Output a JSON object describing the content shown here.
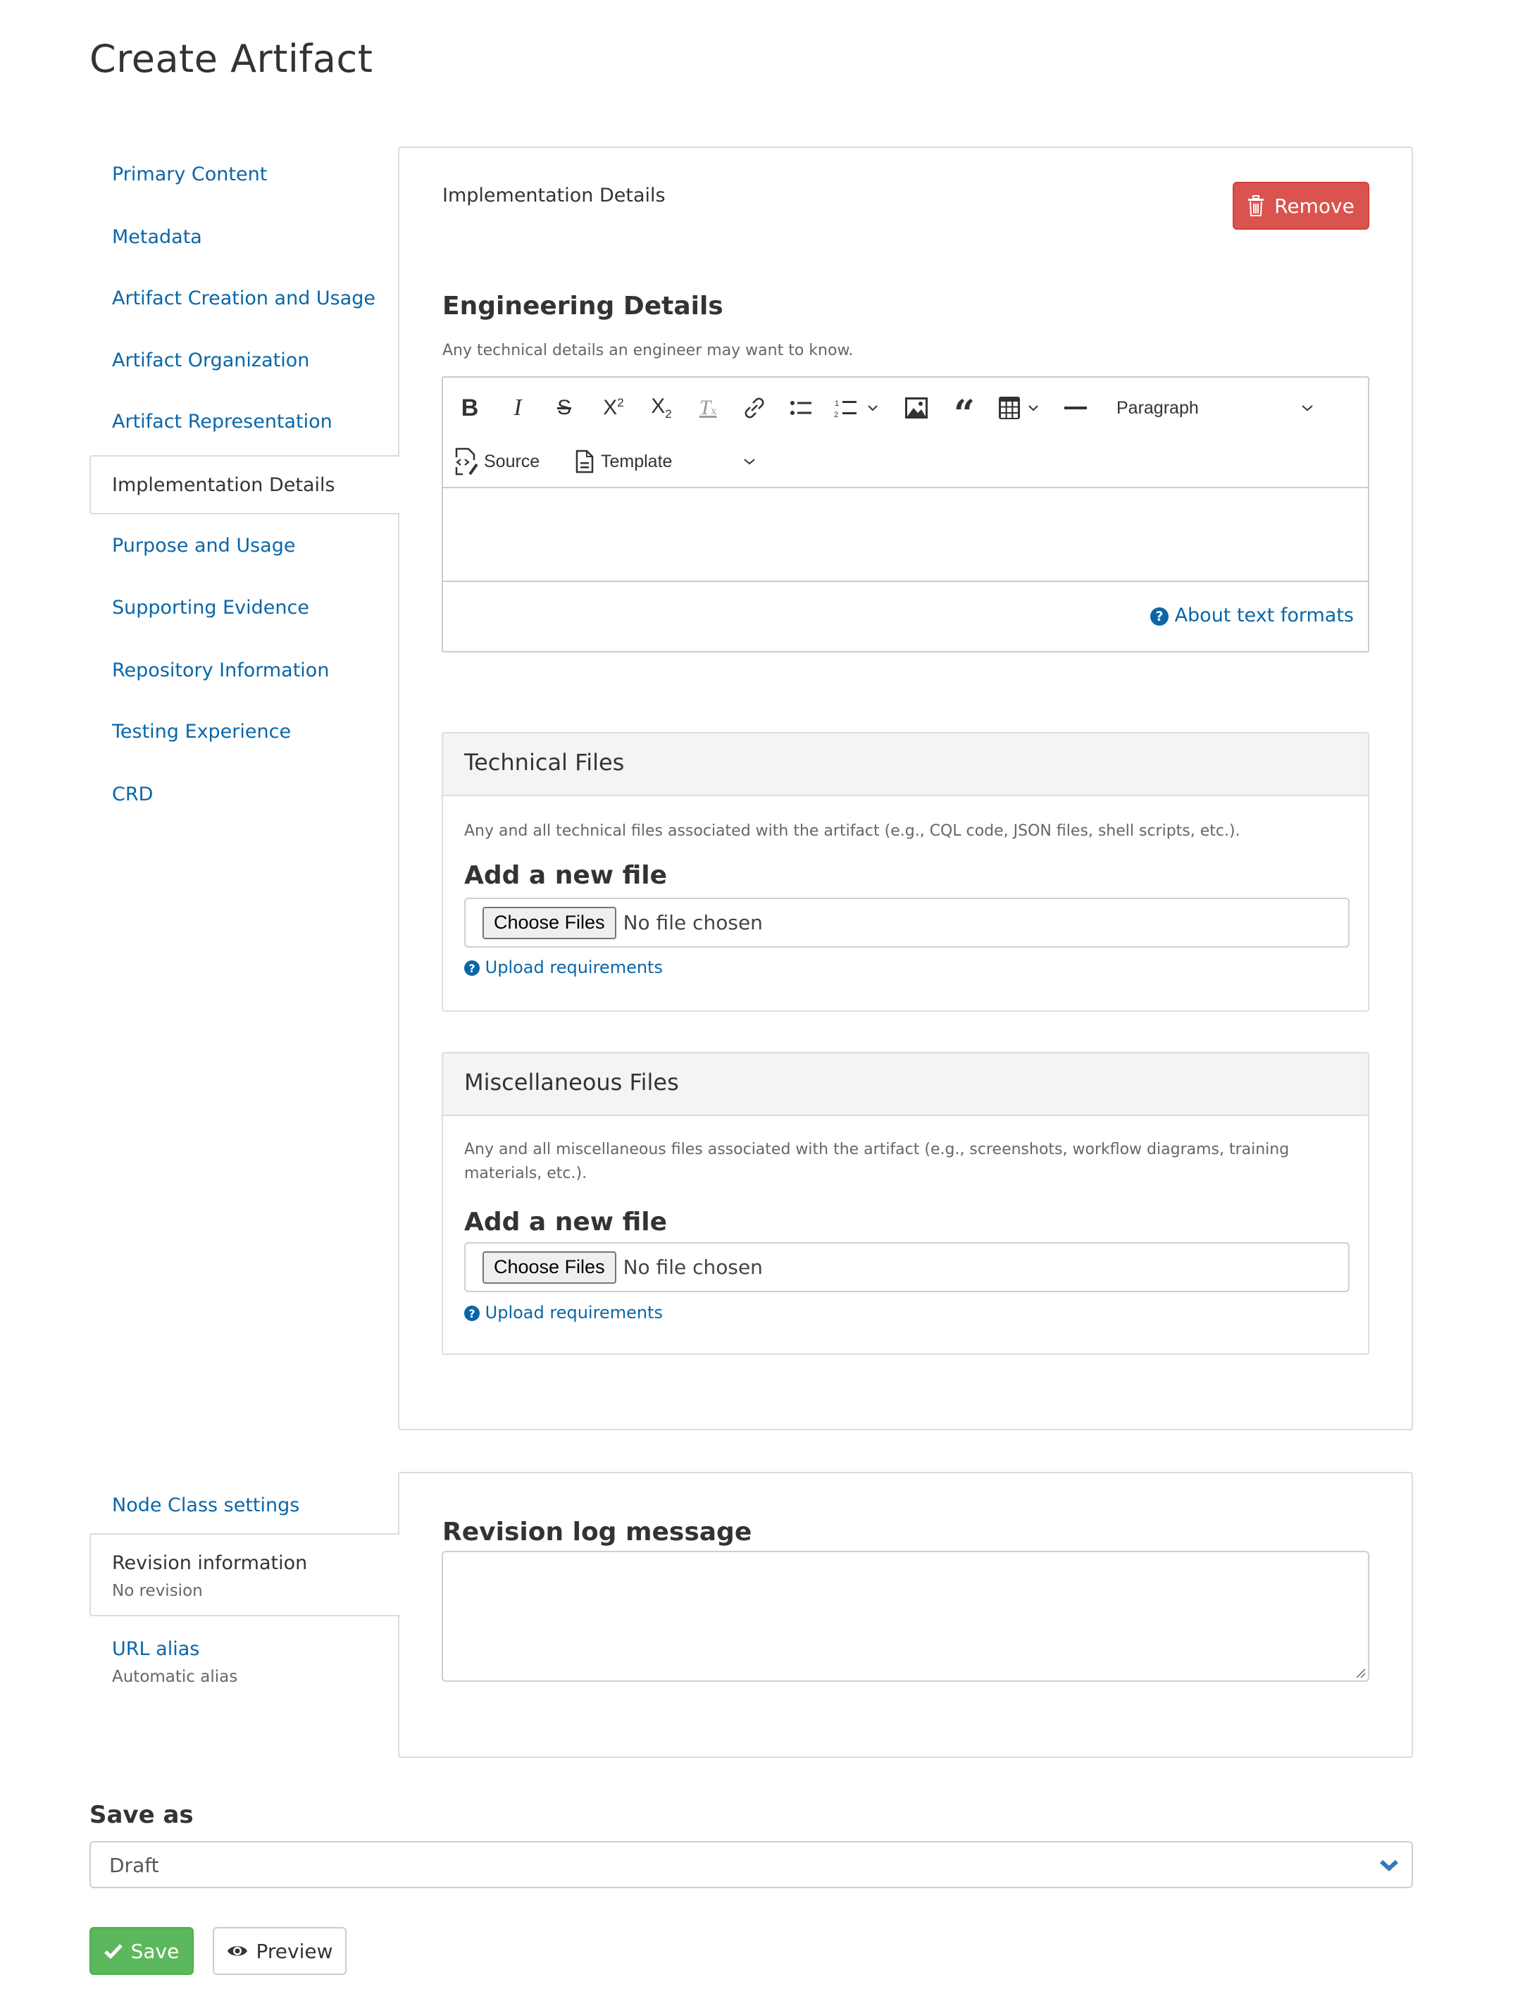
{
  "page": {
    "title": "Create Artifact"
  },
  "sidebar": {
    "items": [
      {
        "label": "Primary Content"
      },
      {
        "label": "Metadata"
      },
      {
        "label": "Artifact Creation and Usage"
      },
      {
        "label": "Artifact Organization"
      },
      {
        "label": "Artifact Representation"
      },
      {
        "label": "Implementation Details",
        "active": true
      },
      {
        "label": "Purpose and Usage"
      },
      {
        "label": "Supporting Evidence"
      },
      {
        "label": "Repository Information"
      },
      {
        "label": "Testing Experience"
      },
      {
        "label": "CRD"
      }
    ]
  },
  "main": {
    "section_label": "Implementation Details",
    "remove_label": "Remove",
    "engineering": {
      "heading": "Engineering Details",
      "description": "Any technical details an engineer may want to know.",
      "toolbar": {
        "buttons": [
          "bold",
          "italic",
          "strikethrough",
          "superscript",
          "subscript",
          "remove-format",
          "link",
          "bulleted-list",
          "numbered-list",
          "image",
          "block-quote",
          "table",
          "horizontal-line"
        ],
        "heading_select": "Paragraph",
        "source_label": "Source",
        "template_label": "Template"
      },
      "content": "",
      "about_formats": "About text formats"
    },
    "technical_files": {
      "title": "Technical Files",
      "description": "Any and all technical files associated with the artifact (e.g., CQL code, JSON files, shell scripts, etc.).",
      "add_heading": "Add a new file",
      "choose_label": "Choose Files",
      "no_file": "No file chosen",
      "requirements": "Upload requirements"
    },
    "misc_files": {
      "title": "Miscellaneous Files",
      "description_line1": "Any and all miscellaneous files associated with the artifact (e.g., screenshots, workflow diagrams, training",
      "description_line2": "materials, etc.).",
      "add_heading": "Add a new file",
      "choose_label": "Choose Files",
      "no_file": "No file chosen",
      "requirements": "Upload requirements"
    }
  },
  "sidebar2": {
    "node_class": "Node Class settings",
    "revision": {
      "label": "Revision information",
      "summary": "No revision"
    },
    "url_alias": {
      "label": "URL alias",
      "summary": "Automatic alias"
    }
  },
  "revision_panel": {
    "heading": "Revision log message",
    "value": ""
  },
  "footer": {
    "save_as_label": "Save as",
    "save_as_value": "Draft",
    "save_label": "Save",
    "preview_label": "Preview"
  },
  "colors": {
    "link": "#0a66a8",
    "danger": "#d9534f",
    "success": "#5cb85c"
  }
}
